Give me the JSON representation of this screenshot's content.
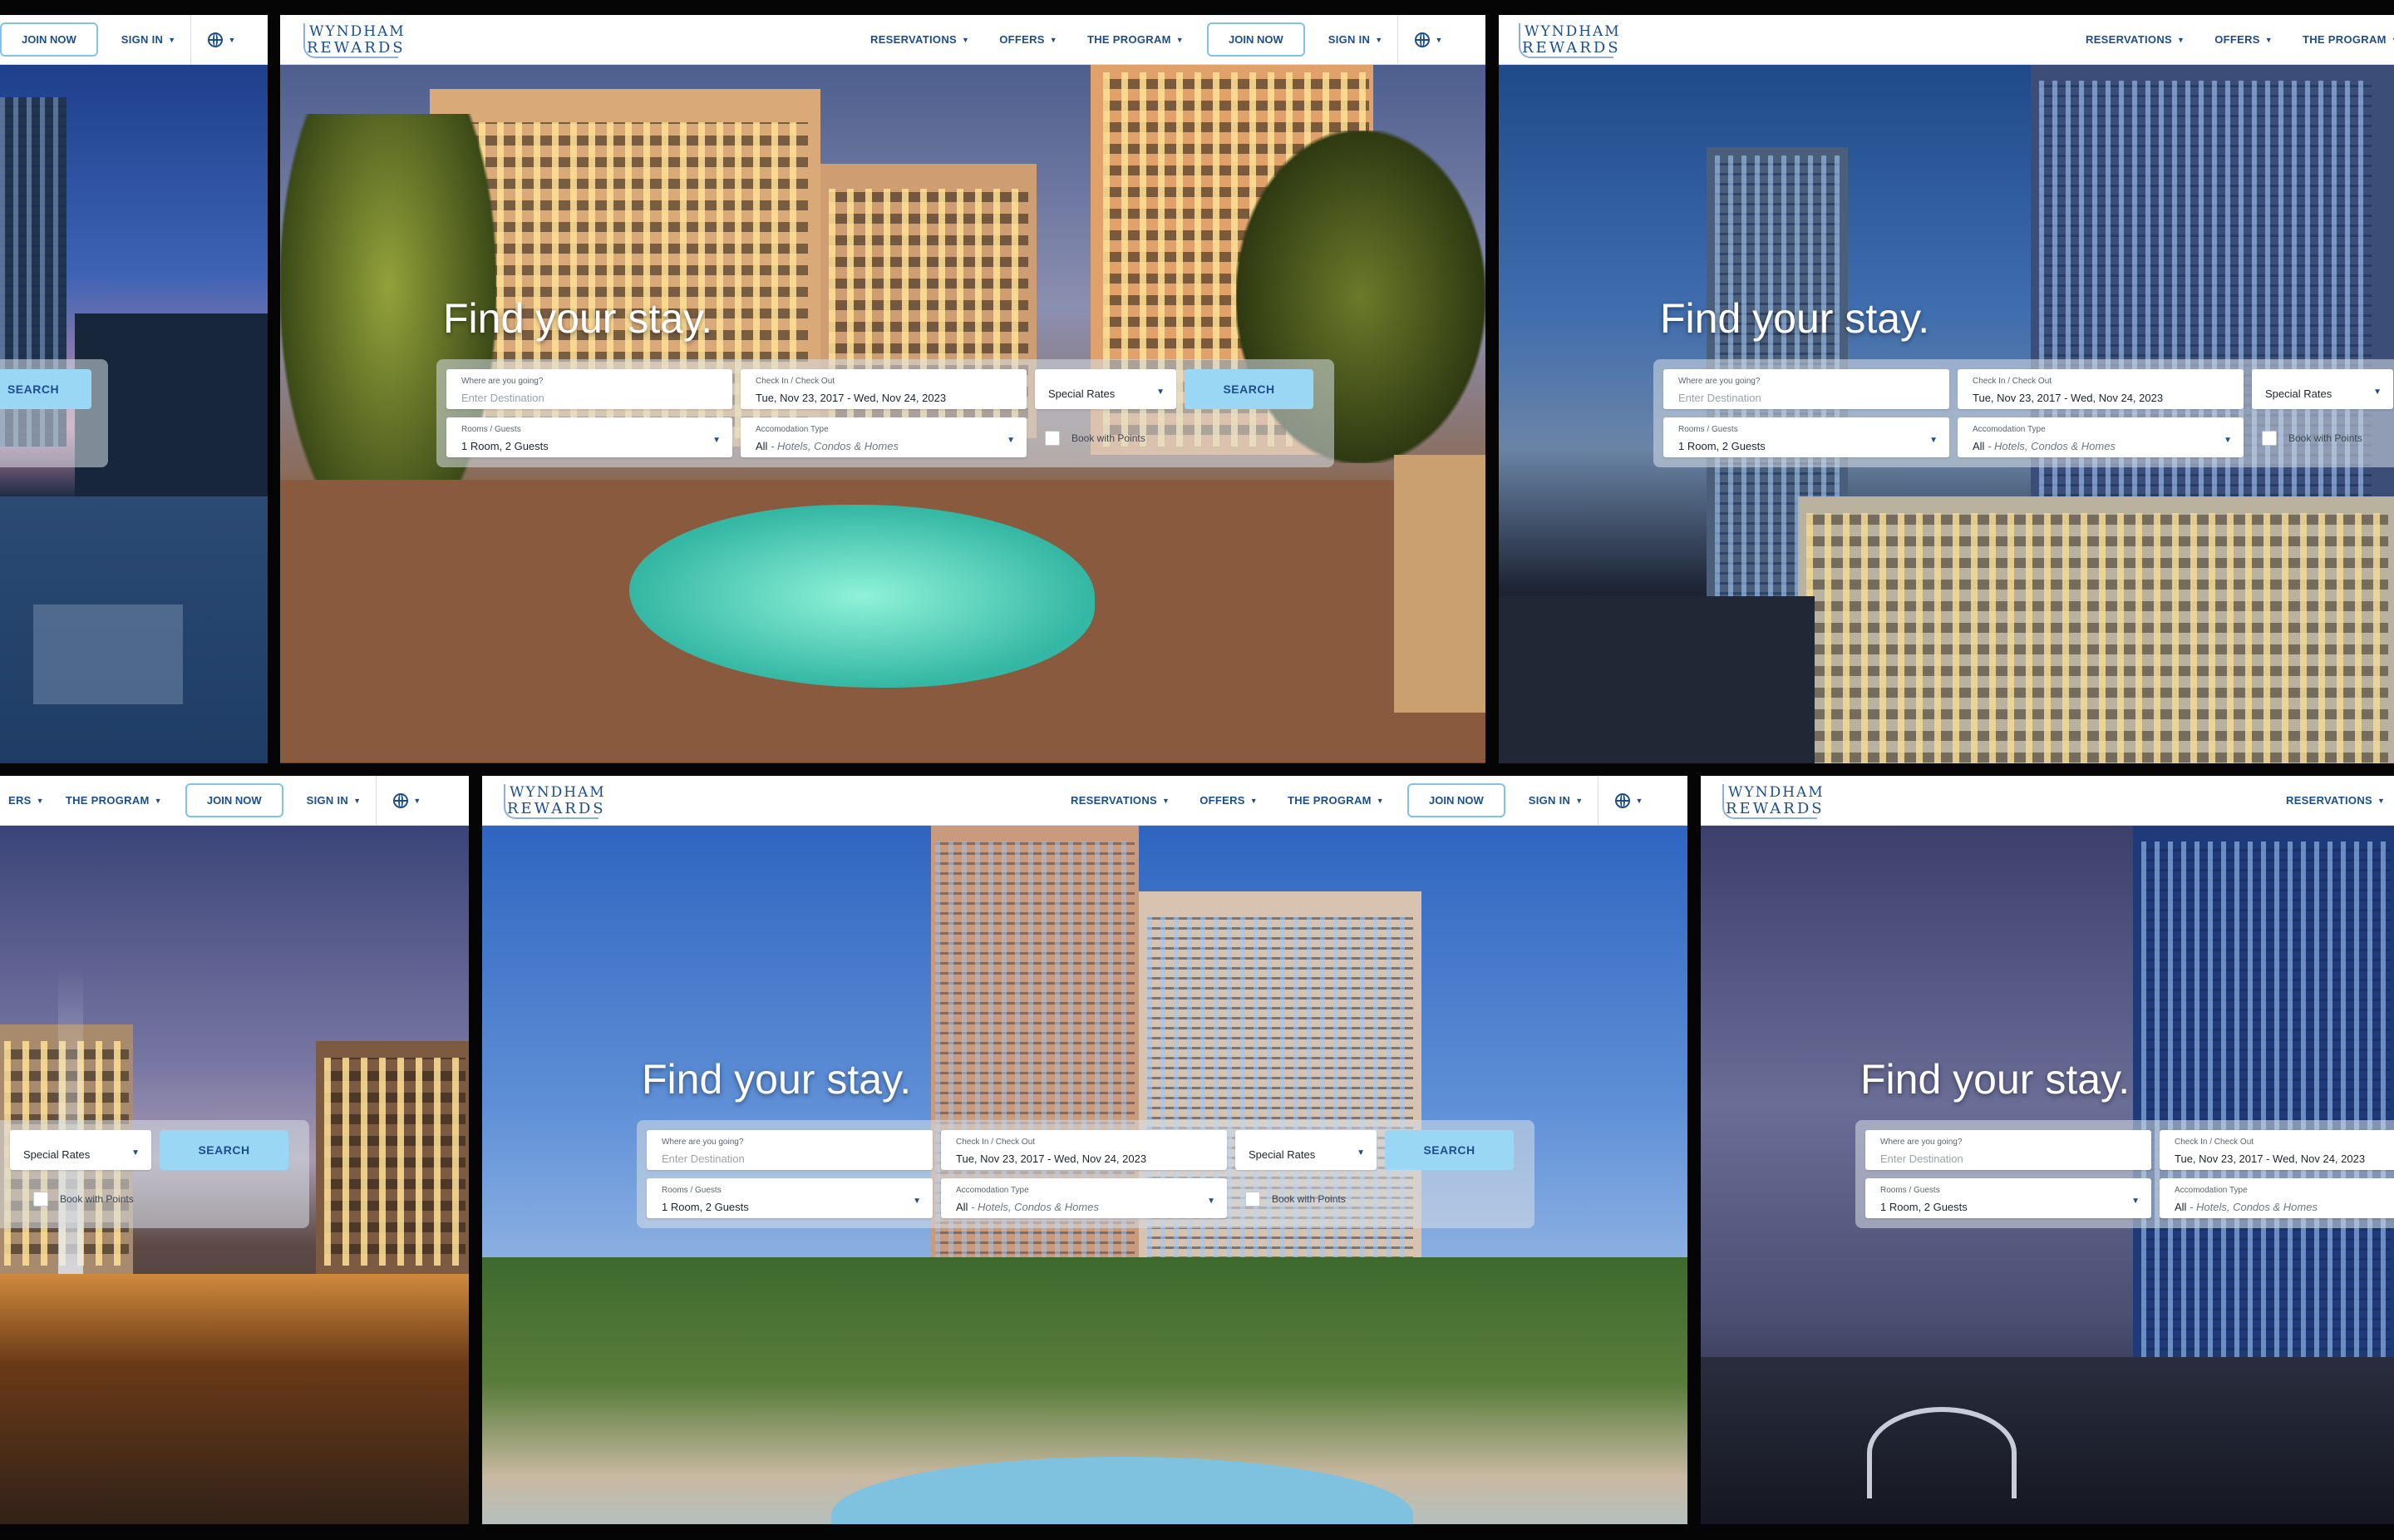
{
  "brand": {
    "logo_line1": "WYNDHAM",
    "logo_line2": "REWARDS",
    "primary_color": "#1b4e8e",
    "accent_color": "#9ad7f5"
  },
  "nav": {
    "reservations": "RESERVATIONS",
    "offers": "OFFERS",
    "program": "THE PROGRAM",
    "program_cropped": "ERS",
    "join": "JOIN NOW",
    "sign_in": "SIGN IN",
    "language_icon": "globe-icon",
    "caret_icon": "caret-down-icon"
  },
  "hero": {
    "headline": "Find your stay."
  },
  "booking": {
    "destination_label": "Where are you going?",
    "destination_placeholder": "Enter Destination",
    "dates_label": "Check In / Check Out",
    "dates_value": "Tue, Nov 23, 2017 - Wed, Nov 24, 2023",
    "rates_value": "Special Rates",
    "search_label": "SEARCH",
    "rooms_label": "Rooms / Guests",
    "rooms_value": "1 Room, 2 Guests",
    "accommodation_label": "Accomodation Type",
    "accommodation_value": "All",
    "accommodation_detail": " - Hotels, Condos & Homes",
    "points_label": "Book with Points"
  }
}
